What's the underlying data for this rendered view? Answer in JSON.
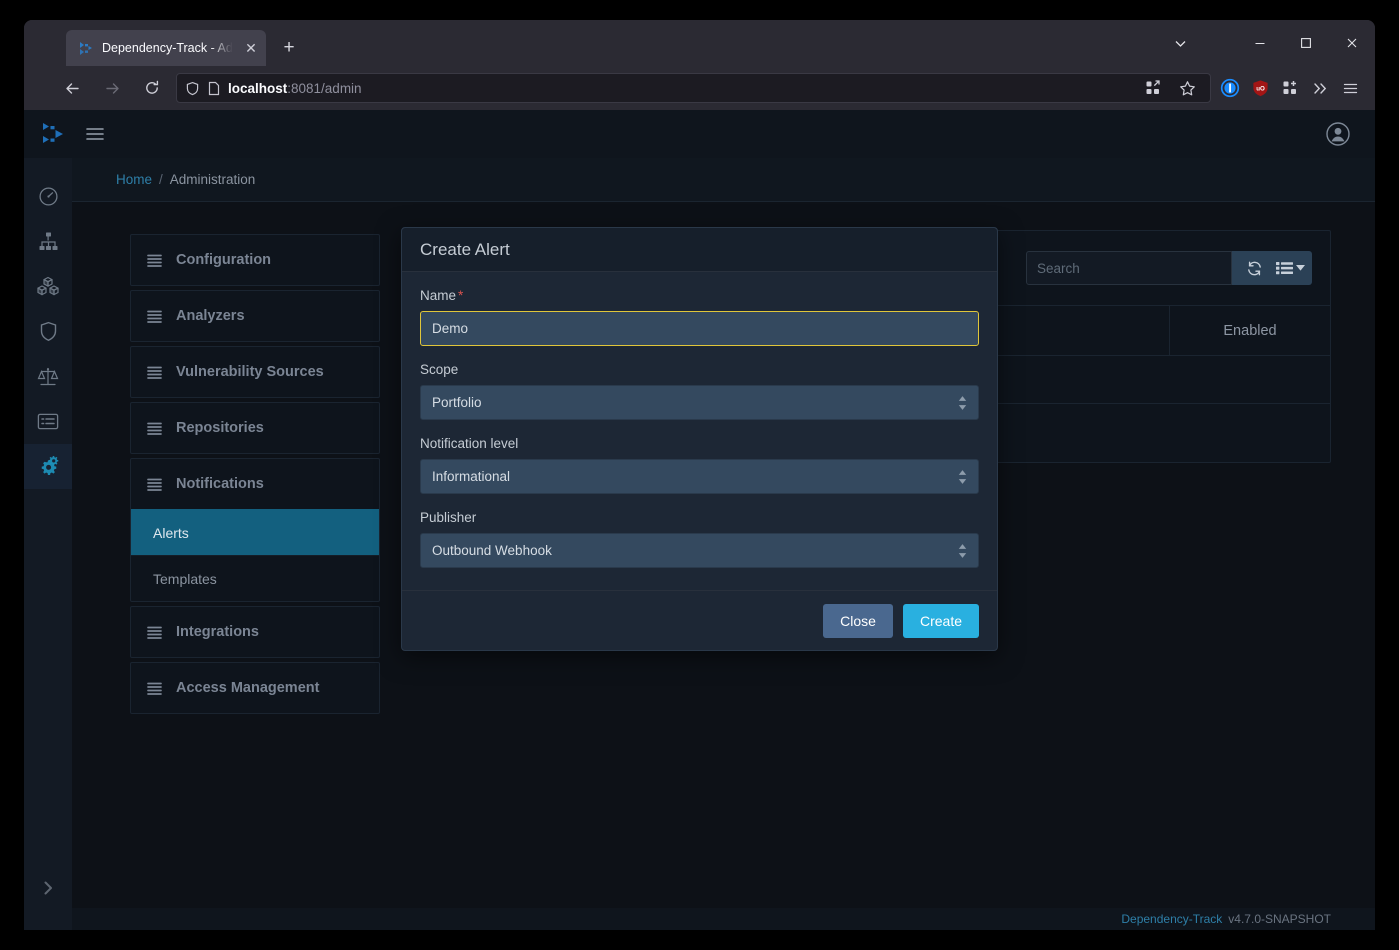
{
  "browser": {
    "tab": {
      "title": "Dependency-Track - Admi",
      "favicon_icon": "dependency-track-logo-icon",
      "close_icon": "close-icon"
    },
    "new_tab_icon": "plus-icon",
    "window_controls": {
      "list_icon": "chevron-down-icon",
      "minimize_icon": "minimize-icon",
      "maximize_icon": "maximize-icon",
      "close_icon": "close-icon"
    },
    "nav": {
      "back_icon": "back-arrow-icon",
      "forward_icon": "forward-arrow-icon",
      "reload_icon": "reload-icon"
    },
    "url": {
      "host": "localhost",
      "rest": ":8081/admin",
      "shield_icon": "shield-icon",
      "page_icon": "page-icon"
    },
    "url_right_icons": [
      "extensions-grid-icon",
      "bookmark-star-icon"
    ],
    "toolbar_icons": [
      "1password-icon",
      "ublock-origin-icon",
      "extensions-puzzle-icon",
      "overflow-chevrons-icon",
      "app-menu-icon"
    ]
  },
  "app": {
    "brand_logo_icon": "dependency-track-logo-icon",
    "hamburger_icon": "hamburger-menu-icon",
    "avatar_icon": "user-avatar-icon",
    "rail": [
      {
        "name": "dashboard",
        "icon": "gauge-icon",
        "active": false
      },
      {
        "name": "projects",
        "icon": "sitemap-icon",
        "active": false
      },
      {
        "name": "components",
        "icon": "cubes-icon",
        "active": false
      },
      {
        "name": "vulnerabilities",
        "icon": "shield-icon",
        "active": false
      },
      {
        "name": "licenses",
        "icon": "scales-icon",
        "active": false
      },
      {
        "name": "policy",
        "icon": "list-alt-icon",
        "active": false
      },
      {
        "name": "administration",
        "icon": "gears-icon",
        "active": true
      }
    ],
    "rail_expand_icon": "chevron-right-icon",
    "breadcrumb": {
      "home": "Home",
      "separator": "/",
      "current": "Administration"
    },
    "footer": {
      "brand": "Dependency-Track",
      "version": "v4.7.0-SNAPSHOT"
    }
  },
  "admin_nav": {
    "groups": [
      {
        "label": "Configuration",
        "icon": "list-icon"
      },
      {
        "label": "Analyzers",
        "icon": "list-icon"
      },
      {
        "label": "Vulnerability Sources",
        "icon": "list-icon"
      },
      {
        "label": "Repositories",
        "icon": "list-icon"
      },
      {
        "label": "Notifications",
        "icon": "list-icon",
        "subitems": [
          {
            "label": "Alerts",
            "active": true
          },
          {
            "label": "Templates",
            "active": false
          }
        ]
      },
      {
        "label": "Integrations",
        "icon": "list-icon"
      },
      {
        "label": "Access Management",
        "icon": "list-icon"
      }
    ]
  },
  "alerts_panel": {
    "search_placeholder": "Search",
    "search_value": "",
    "refresh_icon": "refresh-icon",
    "columns_icon": "columns-list-icon",
    "columns_caret_icon": "caret-down-icon",
    "table": {
      "columns": [
        "",
        "Enabled"
      ],
      "rows": []
    }
  },
  "modal": {
    "title": "Create Alert",
    "fields": {
      "name": {
        "label": "Name",
        "required_marker": "*",
        "value": "Demo",
        "placeholder": ""
      },
      "scope": {
        "label": "Scope",
        "value": "Portfolio"
      },
      "notification_level": {
        "label": "Notification level",
        "value": "Informational"
      },
      "publisher": {
        "label": "Publisher",
        "value": "Outbound Webhook"
      }
    },
    "buttons": {
      "close": "Close",
      "create": "Create"
    }
  },
  "colors": {
    "accent_teal": "#13607f",
    "primary_blue": "#29b0e0",
    "link_blue": "#2e7fa8",
    "invalid_yellow": "#e0c63a",
    "required_red": "#d9534f"
  }
}
